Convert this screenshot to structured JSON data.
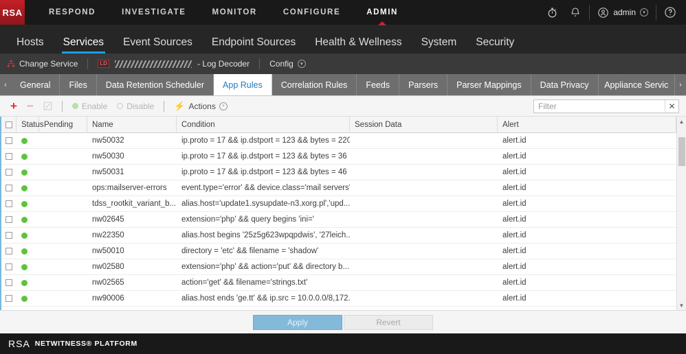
{
  "topnav": {
    "logo": "RSA",
    "items": [
      {
        "label": "RESPOND",
        "active": false
      },
      {
        "label": "INVESTIGATE",
        "active": false
      },
      {
        "label": "MONITOR",
        "active": false
      },
      {
        "label": "CONFIGURE",
        "active": false
      },
      {
        "label": "ADMIN",
        "active": true
      }
    ],
    "timer_icon": "timer-icon",
    "bell_icon": "bell-icon",
    "user_label": "admin",
    "user_icon": "user-icon",
    "user_chevron": "▾",
    "help_icon": "help-icon"
  },
  "subnav": {
    "items": [
      {
        "label": "Hosts",
        "active": false
      },
      {
        "label": "Services",
        "active": true
      },
      {
        "label": "Event Sources",
        "active": false
      },
      {
        "label": "Endpoint Sources",
        "active": false
      },
      {
        "label": "Health & Wellness",
        "active": false
      },
      {
        "label": "System",
        "active": false
      },
      {
        "label": "Security",
        "active": false
      }
    ]
  },
  "breadcrumb": {
    "change_service": "Change Service",
    "service_badge": "LD",
    "service_name_redacted": true,
    "service_type": "- Log Decoder",
    "config": "Config",
    "config_chevron": "▾"
  },
  "tabstrip": {
    "left_arrow": "‹",
    "right_arrow": "›",
    "tabs": [
      {
        "label": "General",
        "active": false
      },
      {
        "label": "Files",
        "active": false
      },
      {
        "label": "Data Retention Scheduler",
        "active": false
      },
      {
        "label": "App Rules",
        "active": true
      },
      {
        "label": "Correlation Rules",
        "active": false
      },
      {
        "label": "Feeds",
        "active": false
      },
      {
        "label": "Parsers",
        "active": false
      },
      {
        "label": "Parser Mappings",
        "active": false
      },
      {
        "label": "Data Privacy",
        "active": false
      },
      {
        "label": "Appliance Servic",
        "active": false
      }
    ]
  },
  "toolbar": {
    "add": "+",
    "remove": "−",
    "edit_icon": "edit-icon",
    "enable": "Enable",
    "disable": "Disable",
    "actions": "Actions",
    "actions_chevron": "▾",
    "filter_placeholder": "Filter",
    "filter_value": "",
    "filter_clear": "✕"
  },
  "grid": {
    "columns": [
      "Status",
      "Pending",
      "Name",
      "Condition",
      "Session Data",
      "Alert"
    ],
    "rows": [
      {
        "name": "nw50032",
        "condition": "ip.proto = 17 && ip.dstport = 123 && bytes = 220",
        "session_data": "",
        "alert": "alert.id",
        "pending": ""
      },
      {
        "name": "nw50030",
        "condition": "ip.proto = 17 && ip.dstport = 123 && bytes = 36",
        "session_data": "",
        "alert": "alert.id",
        "pending": ""
      },
      {
        "name": "nw50031",
        "condition": "ip.proto = 17 && ip.dstport = 123 && bytes = 46",
        "session_data": "",
        "alert": "alert.id",
        "pending": ""
      },
      {
        "name": "ops:mailserver-errors",
        "condition": "event.type='error' && device.class='mail servers'",
        "session_data": "",
        "alert": "alert.id",
        "pending": ""
      },
      {
        "name": "tdss_rootkit_variant_b...",
        "condition": "alias.host='update1.sysupdate-n3.xorg.pl','upd...",
        "session_data": "",
        "alert": "alert.id",
        "pending": ""
      },
      {
        "name": "nw02645",
        "condition": "extension='php' && query begins 'ini='",
        "session_data": "",
        "alert": "alert.id",
        "pending": ""
      },
      {
        "name": "nw22350",
        "condition": "alias.host begins '25z5g623wpqpdwis', '27leich...",
        "session_data": "",
        "alert": "alert.id",
        "pending": ""
      },
      {
        "name": "nw50010",
        "condition": "directory = 'etc' && filename = 'shadow'",
        "session_data": "",
        "alert": "alert.id",
        "pending": ""
      },
      {
        "name": "nw02580",
        "condition": "extension='php' && action='put' && directory b...",
        "session_data": "",
        "alert": "alert.id",
        "pending": ""
      },
      {
        "name": "nw02565",
        "condition": "action='get' && filename='strings.txt'",
        "session_data": "",
        "alert": "alert.id",
        "pending": ""
      },
      {
        "name": "nw90006",
        "condition": "alias.host ends 'ge.tt' && ip.src = 10.0.0.0/8,172...",
        "session_data": "",
        "alert": "alert.id",
        "pending": ""
      }
    ],
    "scroll_up": "▲",
    "scroll_down": "▼"
  },
  "actionbar": {
    "apply": "Apply",
    "revert": "Revert"
  },
  "footer": {
    "logo": "RSA",
    "product": "NETWITNESS® PLATFORM"
  }
}
